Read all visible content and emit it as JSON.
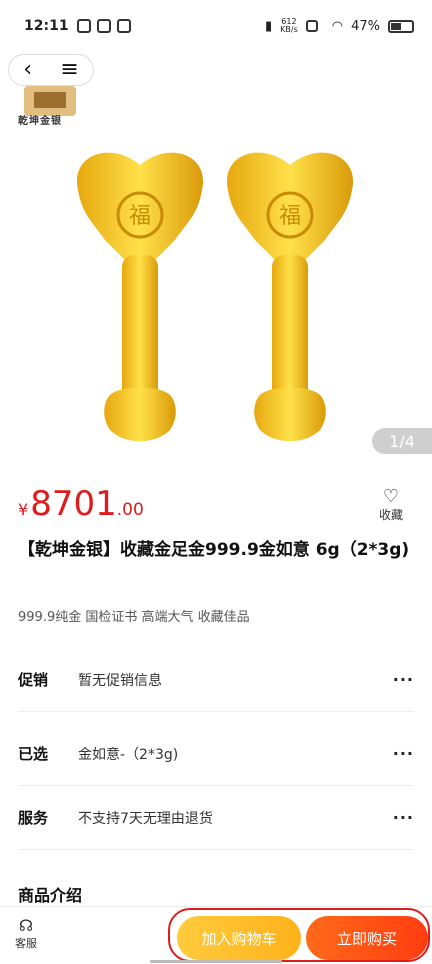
{
  "status_bar": {
    "time": "12:11",
    "speed_value": "612",
    "speed_unit": "KB/s",
    "battery": "47%"
  },
  "gallery": {
    "counter": "1/4",
    "logo_text": "乾坤金银"
  },
  "price": {
    "symbol": "¥",
    "integer": "8701",
    "decimal": ".00"
  },
  "favorite": {
    "label": "收藏"
  },
  "product": {
    "title": "【乾坤金银】收藏金足金999.9金如意 6g（2*3g)",
    "subtitle": "999.9纯金 国检证书 高端大气 收藏佳品"
  },
  "rows": [
    {
      "label": "促销",
      "value": "暂无促销信息",
      "more": "···"
    },
    {
      "label": "已选",
      "value": "金如意-（2*3g)",
      "more": "···"
    },
    {
      "label": "服务",
      "value": "不支持7天无理由退货",
      "more": "···"
    }
  ],
  "section": {
    "intro": "商品介绍"
  },
  "bottom_bar": {
    "service_label": "客服",
    "add_to_cart": "加入购物车",
    "buy_now": "立即购买"
  },
  "colors": {
    "price": "#e01b1b",
    "cart_button": "#ffb21a",
    "buy_button": "#ff4a12",
    "gold": "#f4c21b"
  }
}
